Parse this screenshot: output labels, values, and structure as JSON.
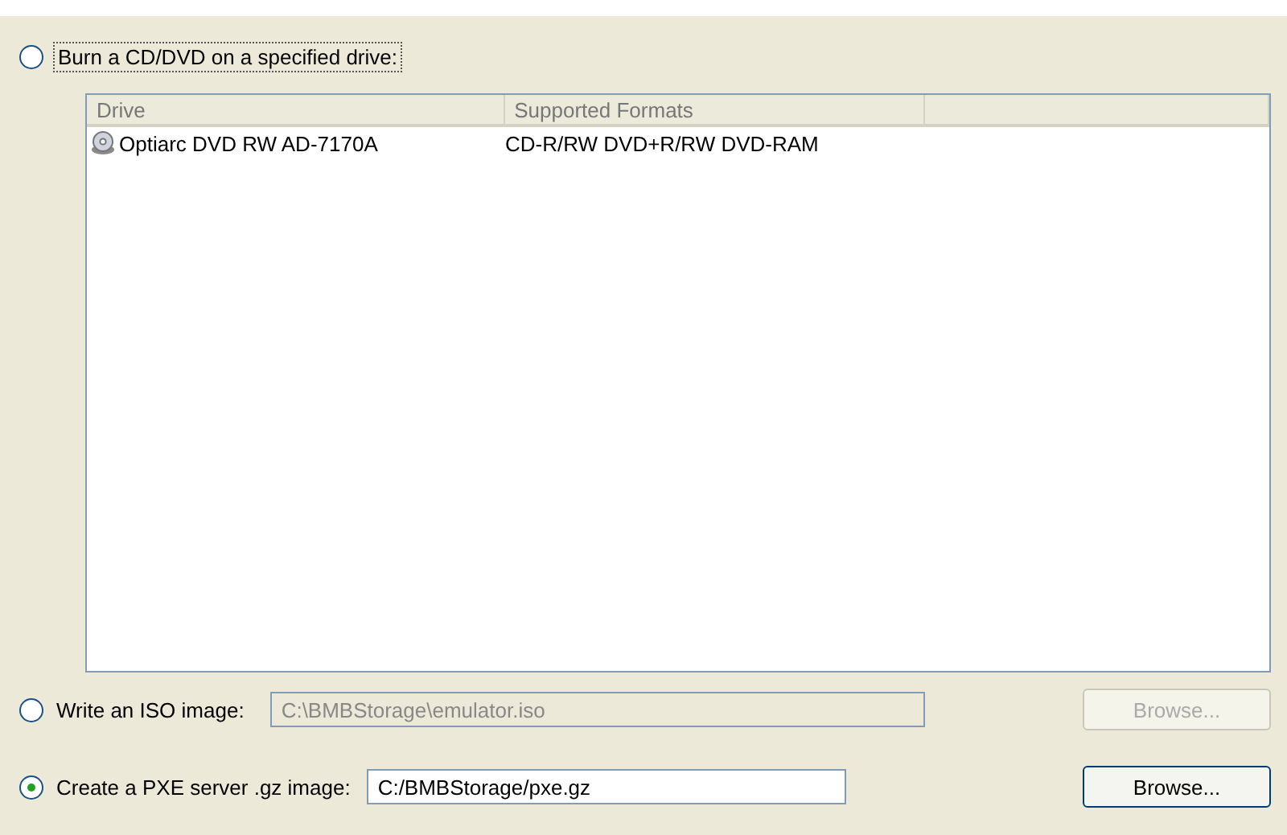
{
  "burn_option": {
    "label": "Burn a CD/DVD on a specified drive:",
    "selected": false
  },
  "drive_list": {
    "columns": [
      "Drive",
      "Supported Formats"
    ],
    "rows": [
      {
        "drive": "Optiarc DVD RW AD-7170A",
        "formats": "CD-R/RW DVD+R/RW DVD-RAM"
      }
    ]
  },
  "options": [
    {
      "label": "Write an ISO image:",
      "selected": false,
      "path": "C:\\BMBStorage\\emulator.iso",
      "disabled": true,
      "button": "Browse..."
    },
    {
      "label": "Create a PXE server .gz image:",
      "selected": true,
      "path": "C:/BMBStorage/pxe.gz",
      "disabled": false,
      "button": "Browse..."
    }
  ]
}
